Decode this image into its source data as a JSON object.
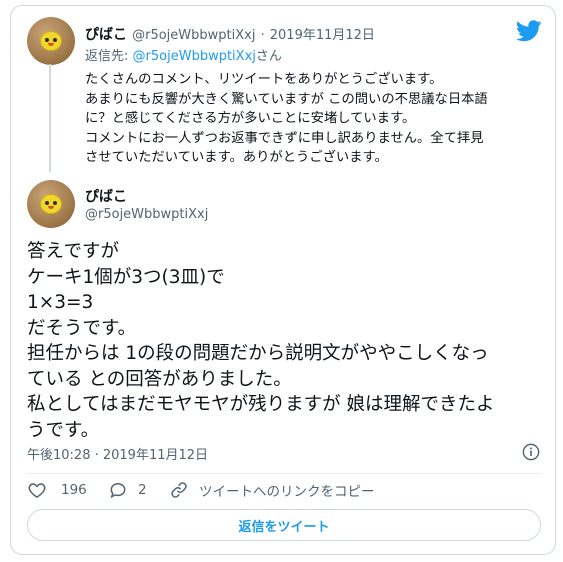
{
  "reply_tweet": {
    "display_name": "ぴばこ",
    "handle": "@r5ojeWbbwptiXxj",
    "separator": "·",
    "date": "2019年11月12日",
    "reply_to_label": "返信先:",
    "reply_to_handle": "@r5ojeWbbwptiXxj",
    "reply_to_suffix": "さん",
    "text_lines": [
      "たくさんのコメント、リツイートをありがとうございます。",
      "あまりにも反響が大きく驚いていますが この問いの不思議な日本語",
      "に？と感じてくださる方が多いことに安堵しています。",
      "コメントにお一人ずつお返事できずに申し訳ありません。全て拝見",
      "させていただいています。ありがとうございます。"
    ]
  },
  "main_tweet": {
    "display_name": "ぴばこ",
    "handle": "@r5ojeWbbwptiXxj",
    "text_lines": [
      "答えですが",
      "ケーキ1個が3つ(3皿)で",
      "1×3=3",
      "だそうです。",
      "担任からは 1の段の問題だから説明文がややこしくなっ",
      "ている との回答がありました。",
      "私としてはまだモヤモヤが残りますが 娘は理解できたよ",
      "うです。"
    ],
    "timestamp": "午後10:28 · 2019年11月12日"
  },
  "actions": {
    "like_count": "196",
    "reply_count": "2",
    "copy_link_label": "ツイートへのリンクをコピー"
  },
  "reply_button_label": "返信をツイート",
  "colors": {
    "accent": "#1d9bf0",
    "secondary_text": "#536471",
    "border": "#cfd9de"
  },
  "icons": [
    "twitter-bird-icon",
    "info-icon",
    "heart-icon",
    "reply-bubble-icon",
    "link-icon"
  ]
}
